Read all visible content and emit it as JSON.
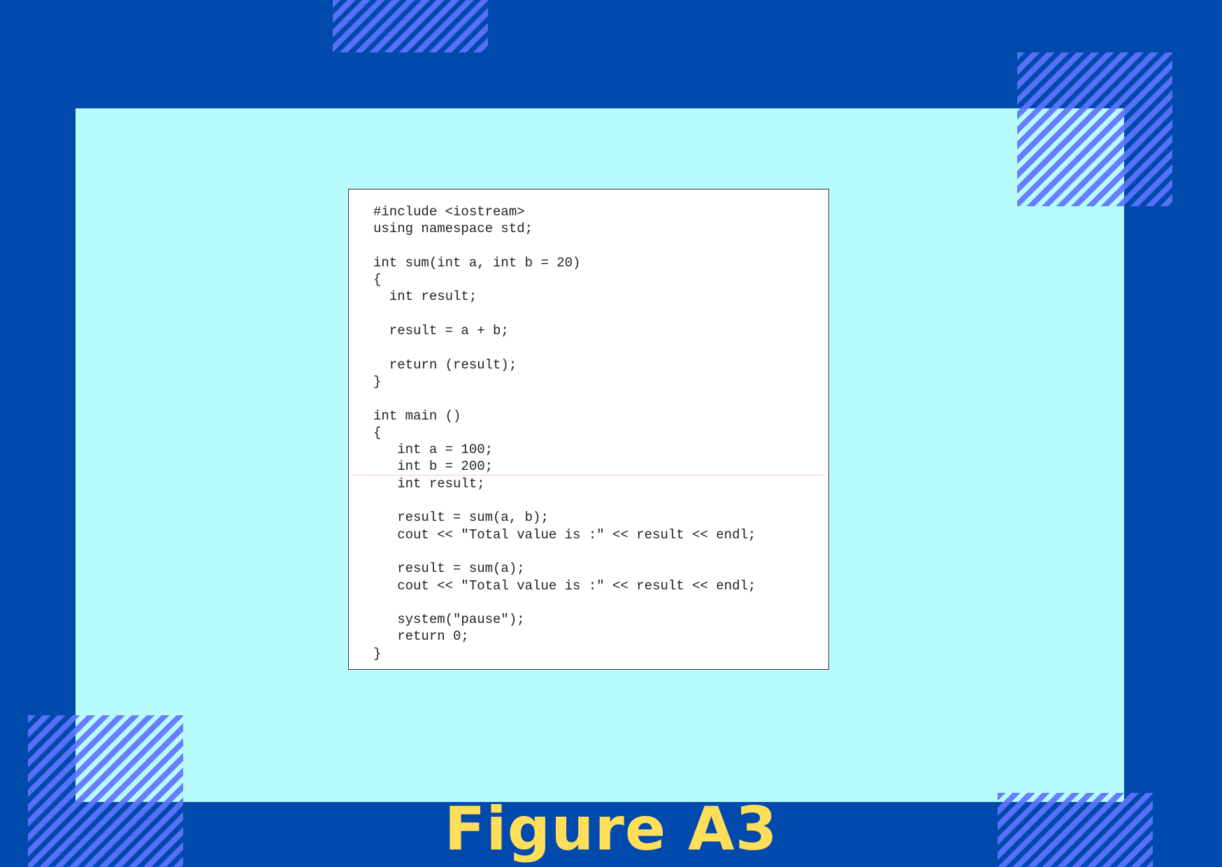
{
  "code_listing": {
    "lines": [
      "#include <iostream>",
      "using namespace std;",
      "",
      "int sum(int a, int b = 20)",
      "{",
      "  int result;",
      "",
      "  result = a + b;",
      "",
      "  return (result);",
      "}",
      "",
      "int main ()",
      "{",
      "   int a = 100;",
      "   int b = 200;",
      "   int result;",
      "",
      "   result = sum(a, b);",
      "   cout << \"Total value is :\" << result << endl;",
      "",
      "   result = sum(a);",
      "   cout << \"Total value is :\" << result << endl;",
      "",
      "   system(\"pause\");",
      "   return 0;",
      "}"
    ]
  },
  "caption": "Figure A3",
  "colors": {
    "background": "#004aad",
    "panel": "#b8fbfd",
    "stripes": "#5f73ff",
    "caption": "#ffde59"
  }
}
